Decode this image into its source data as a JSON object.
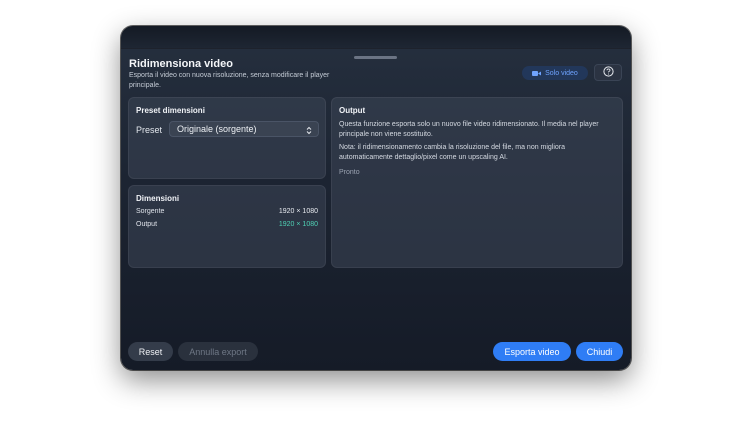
{
  "dialog": {
    "title": "Ridimensiona video",
    "subtitle": "Esporta il video con nuova risoluzione, senza modificare il player principale.",
    "badge_label": "Solo video",
    "help_icon": "question-circle-icon",
    "badge_icon": "video-camera-icon"
  },
  "preset_panel": {
    "title": "Preset dimensioni",
    "label": "Preset",
    "selected": "Originale (sorgente)"
  },
  "dimensions_panel": {
    "title": "Dimensioni",
    "rows": [
      {
        "label": "Sorgente",
        "value": "1920 × 1080"
      },
      {
        "label": "Output",
        "value": "1920 × 1080"
      }
    ]
  },
  "output_panel": {
    "title": "Output",
    "description": "Questa funzione esporta solo un nuovo file video ridimensionato. Il media nel player principale non viene sostituito.",
    "note": "Nota: il ridimensionamento cambia la risoluzione del file, ma non migliora automaticamente dettaglio/pixel come un upscaling AI.",
    "status": "Pronto"
  },
  "footer": {
    "reset_label": "Reset",
    "cancel_label": "Annulla export",
    "export_label": "Esporta video",
    "close_label": "Chiudi"
  },
  "colors": {
    "accent_blue": "#2f7df5",
    "accent_teal": "#4fd1b5",
    "badge_text": "#6fa3ff"
  }
}
